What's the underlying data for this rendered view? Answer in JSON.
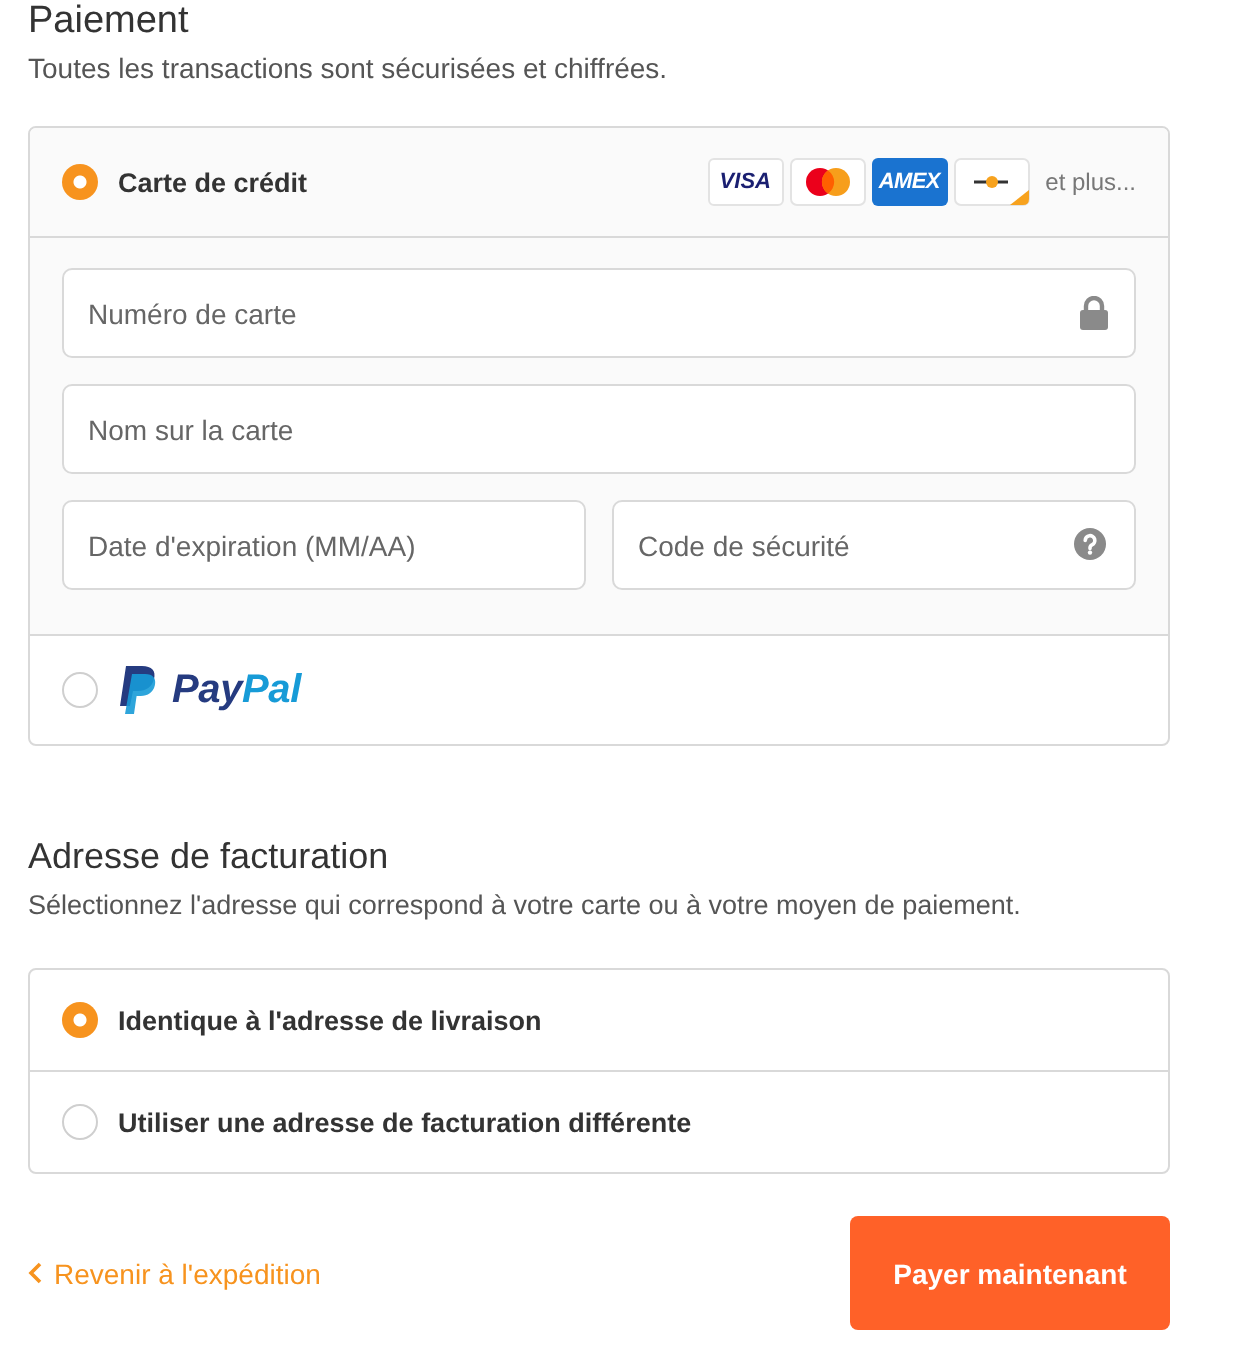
{
  "payment": {
    "title": "Paiement",
    "subtitle": "Toutes les transactions sont sécurisées et chiffrées.",
    "methods": [
      {
        "kind": "card",
        "label": "Carte de crédit",
        "selected": true,
        "brands": [
          {
            "kind": "visa",
            "text": "VISA"
          },
          {
            "kind": "mastercard"
          },
          {
            "kind": "amex",
            "text": "AMEX"
          },
          {
            "kind": "generic"
          }
        ],
        "more": "et plus...",
        "field_rows": [
          [
            {
              "kind": "card_number",
              "placeholder": "Numéro de carte"
            }
          ],
          [
            {
              "kind": "name",
              "placeholder": "Nom sur la carte"
            }
          ],
          [
            {
              "kind": "expiry",
              "placeholder": "Date d'expiration (MM/AA)"
            },
            {
              "kind": "security_code",
              "placeholder": "Code de sécurité"
            }
          ]
        ]
      },
      {
        "kind": "paypal",
        "selected": false,
        "wordmark": [
          "Pay",
          "Pal"
        ]
      }
    ]
  },
  "billing": {
    "title": "Adresse de facturation",
    "subtitle": "Sélectionnez l'adresse qui correspond à votre carte ou à votre moyen de paiement.",
    "options": [
      {
        "label": "Identique à l'adresse de livraison",
        "selected": true
      },
      {
        "label": "Utiliser une adresse de facturation différente",
        "selected": false
      }
    ]
  },
  "footer": {
    "back_link": "Revenir à l'expédition",
    "submit": "Payer maintenant"
  }
}
